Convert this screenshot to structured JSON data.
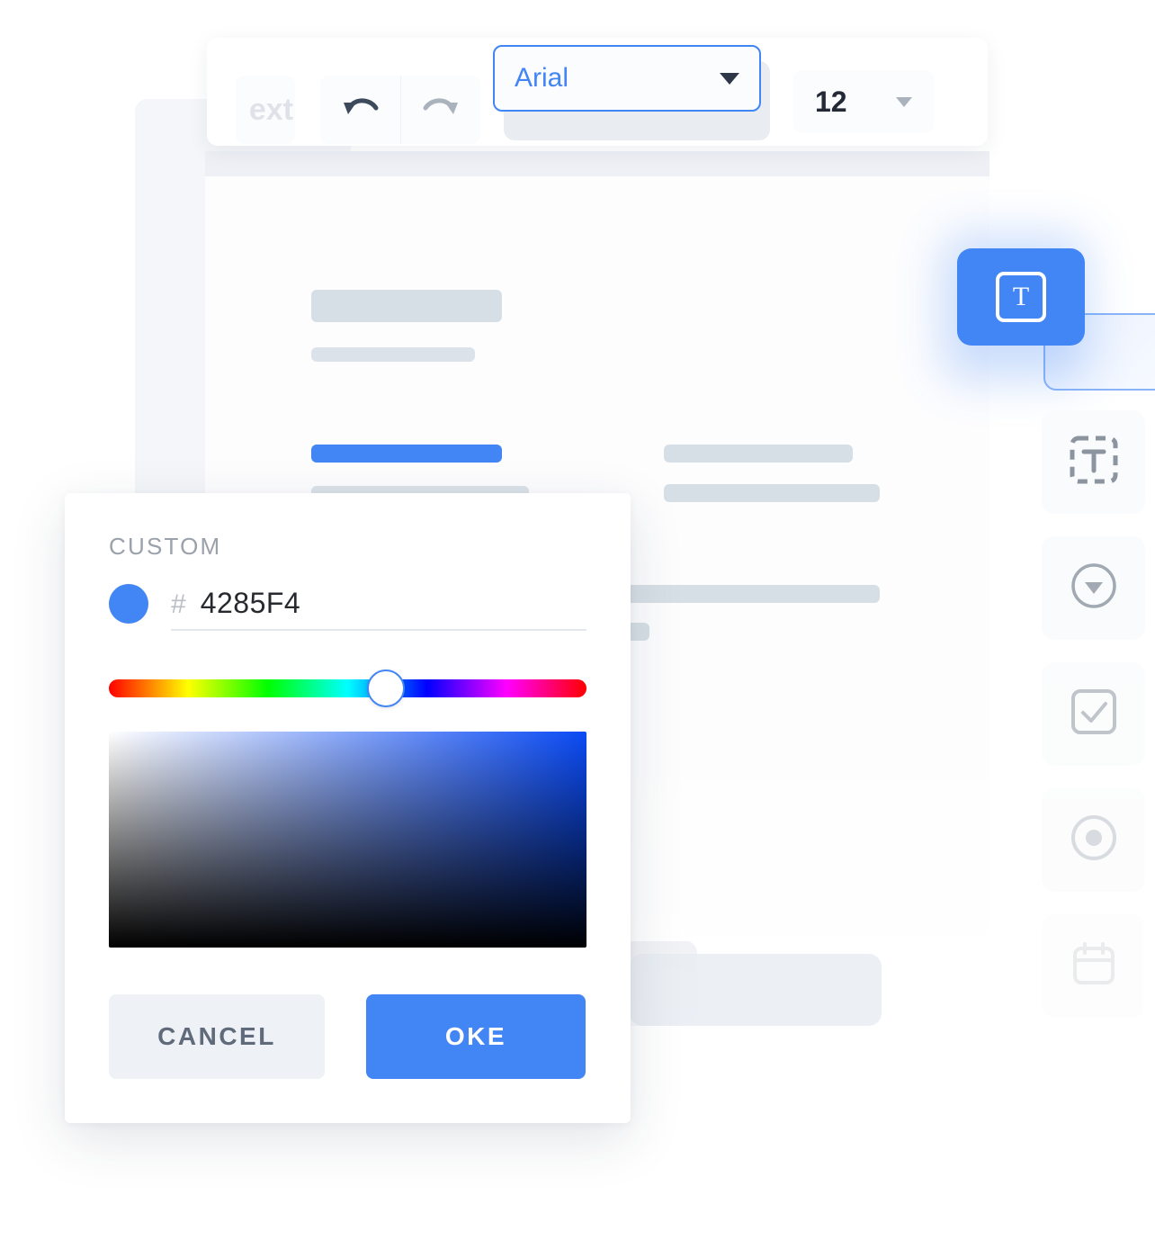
{
  "toolbar": {
    "text_button_label": "ext",
    "undo_icon": "undo-icon",
    "redo_icon": "redo-icon",
    "font_family": {
      "value": "Arial",
      "caret_icon": "chevron-down-icon"
    },
    "font_size": {
      "value": "12",
      "caret_icon": "chevron-down-icon"
    }
  },
  "widget_card": {
    "icon": "text-field-icon",
    "glyph": "T"
  },
  "rail": {
    "items": [
      {
        "icon": "text-input-icon",
        "glyph": "T"
      },
      {
        "icon": "dropdown-icon"
      },
      {
        "icon": "checkbox-icon"
      },
      {
        "icon": "radio-button-icon"
      },
      {
        "icon": "calendar-icon"
      }
    ]
  },
  "color_picker": {
    "title": "CUSTOM",
    "swatch_color": "#4285F4",
    "hex_prefix": "#",
    "hex_value": "4285F4",
    "hue_position_percent": 58,
    "cancel_label": "CANCEL",
    "ok_label": "OKE"
  },
  "colors": {
    "accent": "#4285F4",
    "skeleton": "#D7DFE6",
    "muted_text": "#9AA1AB",
    "cancel_bg": "#EEF1F5",
    "cancel_text": "#5F6B7A"
  }
}
